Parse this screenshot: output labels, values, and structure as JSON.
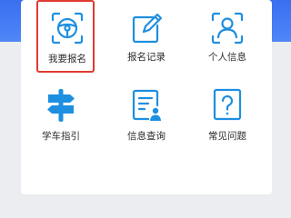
{
  "menu": {
    "items": [
      {
        "label": "我要报名",
        "icon": "steering-wheel-icon",
        "selected": true
      },
      {
        "label": "报名记录",
        "icon": "edit-document-icon",
        "selected": false
      },
      {
        "label": "个人信息",
        "icon": "user-profile-icon",
        "selected": false
      },
      {
        "label": "学车指引",
        "icon": "signpost-icon",
        "selected": false
      },
      {
        "label": "信息查询",
        "icon": "document-user-icon",
        "selected": false
      },
      {
        "label": "常见问题",
        "icon": "question-icon",
        "selected": false
      }
    ],
    "colors": {
      "icon": "#1d8fe0",
      "selected_border": "#e03a30",
      "header": "#3a6ff0"
    }
  }
}
